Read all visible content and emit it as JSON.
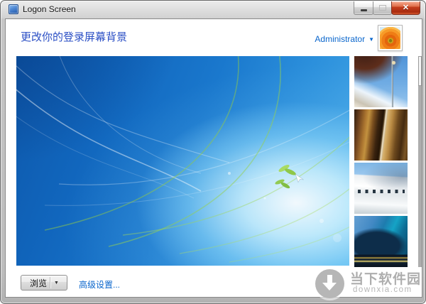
{
  "window": {
    "title": "Logon Screen",
    "controls": {
      "close_glyph": "✕"
    }
  },
  "header": {
    "title": "更改你的登录屏幕背景",
    "user_menu_label": "Administrator",
    "dropdown_glyph": "▼"
  },
  "preview": {
    "description": "windows-7-default-wallpaper-preview"
  },
  "sidebar": {
    "thumbnails": [
      {
        "name": "architecture-space-needle"
      },
      {
        "name": "architecture-copper-curves"
      },
      {
        "name": "architecture-white-ribbon-building"
      },
      {
        "name": "architecture-blue-fin"
      }
    ]
  },
  "footer": {
    "browse_label": "浏览",
    "browse_arrow_glyph": "▼",
    "advanced_label": "高级设置..."
  },
  "watermark": {
    "site_name": "当下软件园",
    "site_url": "downxia.com"
  },
  "colors": {
    "header_text": "#2b4fc5",
    "link": "#0a66cc",
    "close_button": "#c43d1c",
    "wallpaper_blue": "#1a78cd",
    "wallpaper_glow": "#d6f6ff",
    "logo_green": "#8cc63f"
  }
}
